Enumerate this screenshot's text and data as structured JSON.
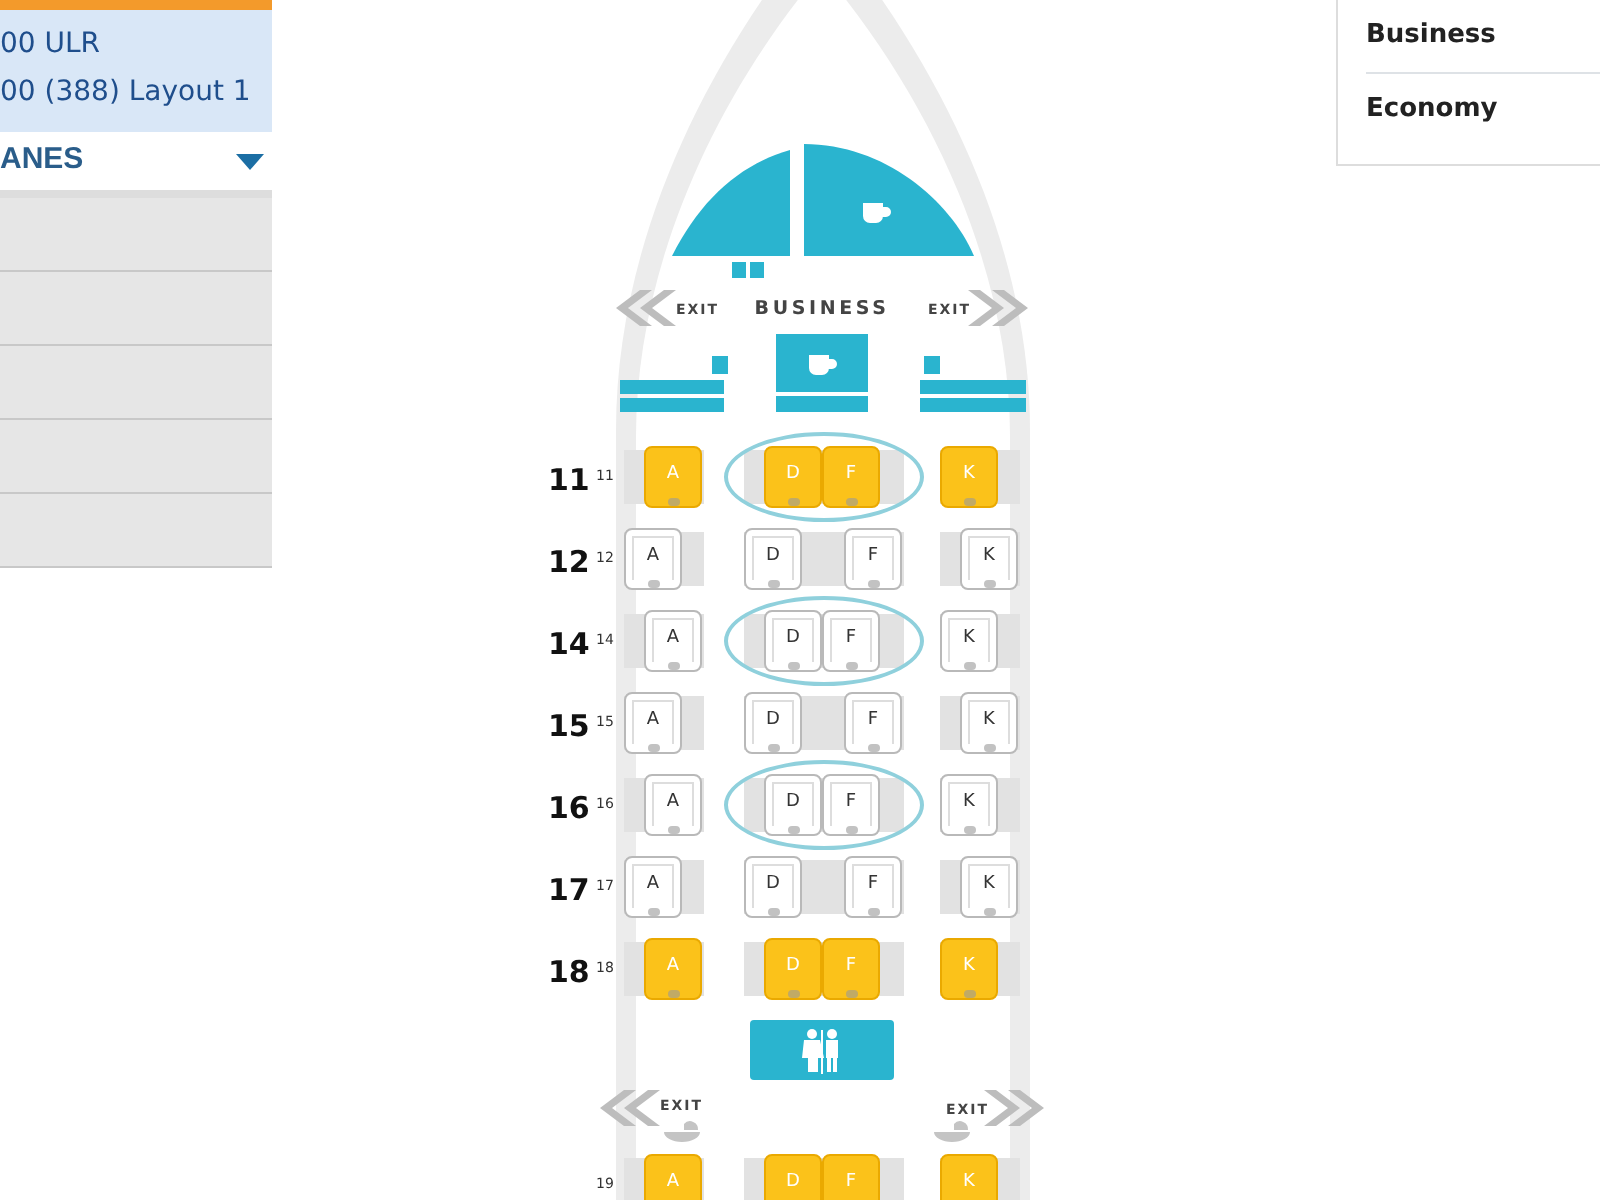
{
  "sidebar": {
    "aircraft": [
      {
        "label": "00 ULR"
      },
      {
        "label": "00 (388) Layout 1"
      }
    ],
    "section_header": "ANES"
  },
  "seat_map": {
    "front": {
      "exit_left": "EXIT",
      "cabin_label": "BUSINESS",
      "exit_right": "EXIT"
    },
    "cabin": [
      {
        "kind": "row",
        "number": "11",
        "small_number": "11",
        "staggered": false,
        "bassinet": true,
        "color": "#fbc21a",
        "seats": [
          "A",
          "D",
          "F",
          "K"
        ]
      },
      {
        "kind": "row",
        "number": "12",
        "small_number": "12",
        "staggered": true,
        "bassinet": false,
        "color": "#ffffff",
        "seats": [
          "A",
          "D",
          "F",
          "K"
        ]
      },
      {
        "kind": "row",
        "number": "14",
        "small_number": "14",
        "staggered": false,
        "bassinet": true,
        "color": "#ffffff",
        "seats": [
          "A",
          "D",
          "F",
          "K"
        ]
      },
      {
        "kind": "row",
        "number": "15",
        "small_number": "15",
        "staggered": true,
        "bassinet": false,
        "color": "#ffffff",
        "seats": [
          "A",
          "D",
          "F",
          "K"
        ]
      },
      {
        "kind": "row",
        "number": "16",
        "small_number": "16",
        "staggered": false,
        "bassinet": true,
        "color": "#ffffff",
        "seats": [
          "A",
          "D",
          "F",
          "K"
        ]
      },
      {
        "kind": "row",
        "number": "17",
        "small_number": "17",
        "staggered": true,
        "bassinet": false,
        "color": "#ffffff",
        "seats": [
          "A",
          "D",
          "F",
          "K"
        ]
      },
      {
        "kind": "row",
        "number": "18",
        "small_number": "18",
        "staggered": false,
        "bassinet": false,
        "color": "#fbc21a",
        "seats": [
          "A",
          "D",
          "F",
          "K"
        ]
      },
      {
        "kind": "lavatory"
      },
      {
        "kind": "exit",
        "left": "EXIT",
        "right": "EXIT"
      },
      {
        "kind": "row",
        "small_number": "19",
        "staggered": false,
        "bassinet": false,
        "color": "#fbc21a",
        "seats": [
          "A",
          "D",
          "F",
          "K"
        ]
      }
    ]
  },
  "cabin_classes": [
    {
      "label": "Business"
    },
    {
      "label": "Economy"
    }
  ]
}
